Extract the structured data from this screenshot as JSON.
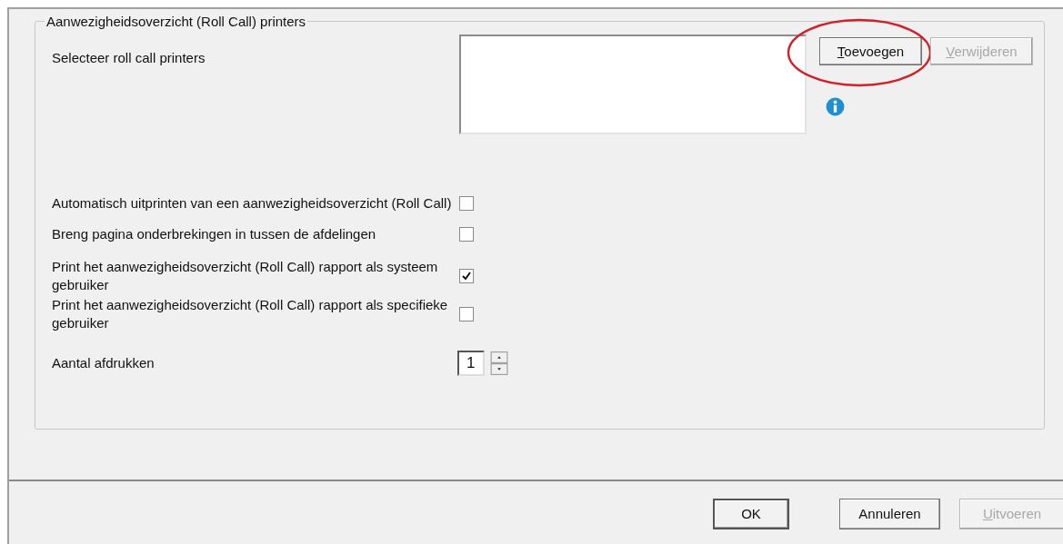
{
  "group": {
    "title": "Aanwezigheidsoverzicht (Roll Call) printers",
    "printer_label": "Selecteer roll call printers",
    "buttons": [
      {
        "label": "Toevoegen",
        "disabled": false,
        "mnemonic_first": true,
        "highlighted": true
      },
      {
        "label": "Verwijderen",
        "disabled": true,
        "mnemonic_first": true,
        "highlighted": false
      }
    ],
    "options": [
      {
        "label": "Automatisch uitprinten van een aanwezigheidsoverzicht (Roll Call)",
        "checked": false
      },
      {
        "label": "Breng pagina onderbrekingen in tussen de afdelingen",
        "checked": false
      },
      {
        "label": "Print het aanwezigheidsoverzicht (Roll Call) rapport als systeem gebruiker",
        "checked": true
      },
      {
        "label": "Print het aanwezigheidsoverzicht (Roll Call) rapport als specifieke gebruiker",
        "checked": false
      }
    ],
    "copies": {
      "label": "Aantal afdrukken",
      "value": "1"
    }
  },
  "footer_buttons": [
    {
      "label": "OK",
      "default": true,
      "disabled": false,
      "mnemonic_first": false
    },
    {
      "label": "Annuleren",
      "default": false,
      "disabled": false,
      "mnemonic_first": false
    },
    {
      "label": "Uitvoeren",
      "default": false,
      "disabled": true,
      "mnemonic_first": true
    }
  ]
}
